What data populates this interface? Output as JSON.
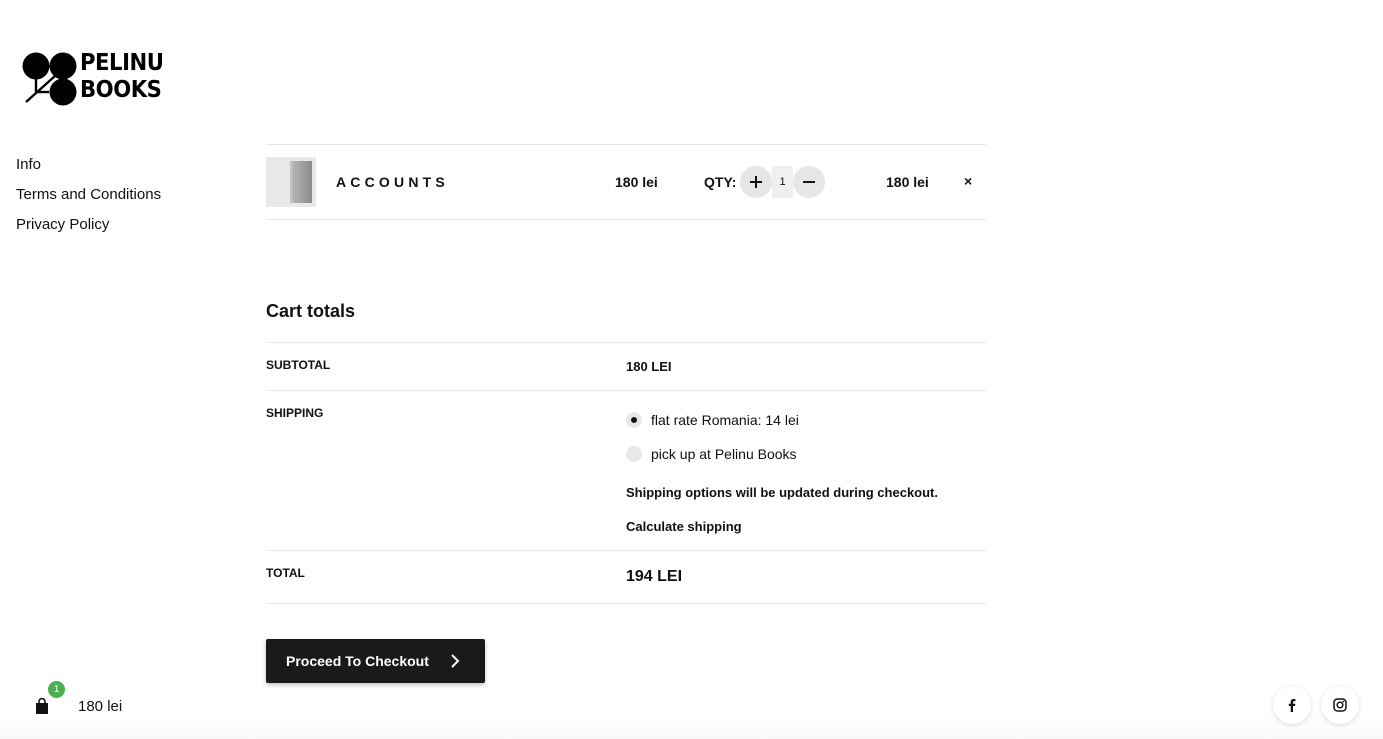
{
  "brand": {
    "logo_text_line1": "PELINU",
    "logo_text_line2": "BOOKS"
  },
  "side_nav": [
    {
      "label": "Info"
    },
    {
      "label": "Terms and Conditions"
    },
    {
      "label": "Privacy Policy"
    }
  ],
  "cart": {
    "items": [
      {
        "name": "ACCOUNTS",
        "price": "180 lei",
        "qty_label": "QTY:",
        "qty": "1",
        "qty_plus_icon": "plus-icon",
        "qty_minus_icon": "minus-icon",
        "line_total": "180 lei",
        "remove": "×"
      }
    ]
  },
  "totals": {
    "title": "Cart totals",
    "subtotal_label": "SUBTOTAL",
    "subtotal_value": "180 LEI",
    "shipping_label": "SHIPPING",
    "shipping_options": [
      {
        "label": "flat rate Romania: 14 lei",
        "selected": true
      },
      {
        "label": "pick up at Pelinu Books",
        "selected": false
      }
    ],
    "shipping_note": "Shipping options will be updated during checkout.",
    "calculate_shipping": "Calculate shipping",
    "total_label": "TOTAL",
    "total_value": "194 LEI"
  },
  "checkout_button": {
    "label": "Proceed To Checkout",
    "icon": "chevron-right-icon"
  },
  "mini_cart": {
    "count": "1",
    "total": "180 lei",
    "icon": "shopping-bag-icon"
  },
  "social": {
    "facebook_icon": "facebook-icon",
    "instagram_icon": "instagram-icon"
  },
  "colors": {
    "button_bg": "#1a1a1a",
    "badge": "#4caf50",
    "qty_button_bg": "#e6e6e6"
  }
}
